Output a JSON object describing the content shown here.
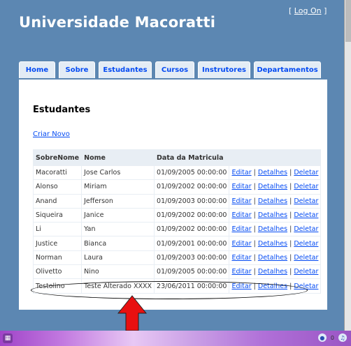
{
  "header": {
    "app_title": "Universidade Macoratti",
    "login_open": "[",
    "login_label": "Log On",
    "login_close": "]"
  },
  "nav": {
    "tabs": [
      {
        "label": "Home"
      },
      {
        "label": "Sobre"
      },
      {
        "label": "Estudantes"
      },
      {
        "label": "Cursos"
      },
      {
        "label": "Instrutores"
      },
      {
        "label": "Departamentos"
      }
    ]
  },
  "main": {
    "title": "Estudantes",
    "create_link": "Criar Novo",
    "table": {
      "headers": [
        "SobreNome",
        "Nome",
        "Data da Matricula",
        ""
      ],
      "action_labels": {
        "edit": "Editar",
        "details": "Detalhes",
        "delete": "Deletar",
        "separator": "|"
      },
      "rows": [
        {
          "sobrenome": "Macoratti",
          "nome": "Jose Carlos",
          "data": "01/09/2005 00:00:00"
        },
        {
          "sobrenome": "Alonso",
          "nome": "Miriam",
          "data": "01/09/2002 00:00:00"
        },
        {
          "sobrenome": "Anand",
          "nome": "Jefferson",
          "data": "01/09/2003 00:00:00"
        },
        {
          "sobrenome": "Siqueira",
          "nome": "Janice",
          "data": "01/09/2002 00:00:00"
        },
        {
          "sobrenome": "Li",
          "nome": "Yan",
          "data": "01/09/2002 00:00:00"
        },
        {
          "sobrenome": "Justice",
          "nome": "Bianca",
          "data": "01/09/2001 00:00:00"
        },
        {
          "sobrenome": "Norman",
          "nome": "Laura",
          "data": "01/09/2003 00:00:00"
        },
        {
          "sobrenome": "Olivetto",
          "nome": "Nino",
          "data": "01/09/2005 00:00:00"
        },
        {
          "sobrenome": "Testolino",
          "nome": "Teste Alterado XXXX",
          "data": "23/06/2011 00:00:00"
        }
      ]
    }
  },
  "annotation": {
    "arrow_color": "#e81010",
    "ellipse_color": "#000000"
  },
  "taskbar": {
    "start_icon": "windows-start-icon",
    "tray_icons": [
      "network-icon",
      "volume-icon"
    ],
    "tray_text": "0"
  },
  "colors": {
    "background": "#5c87b2",
    "link": "#034af3",
    "tab_background": "#e3ecf5",
    "table_header": "#e8eef4"
  }
}
